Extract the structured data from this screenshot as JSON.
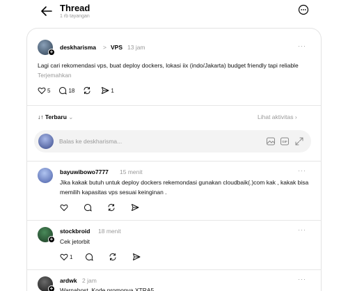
{
  "header": {
    "title": "Thread",
    "subtitle": "1 rb tayangan"
  },
  "post": {
    "username": "deskharisma",
    "separator": ">",
    "community": "VPS",
    "time": "13 jam",
    "more": "···",
    "text": "Lagi cari rekomendasi vps, buat deploy dockers, lokasi iix (indo/Jakarta) budget friendly tapi reliable",
    "translate": "Terjemahkan",
    "likes": "5",
    "comments": "18",
    "reposts": "",
    "shares": "1"
  },
  "sort": {
    "label": "Terbaru",
    "activity": "Lihat aktivitas"
  },
  "reply_box": {
    "placeholder": "Balas ke deskharisma..."
  },
  "replies": [
    {
      "username": "bayuwibowo7777",
      "time": "15 menit",
      "more": "···",
      "text": "Jika kakak butuh untuk deploy dockers rekemondasi gunakan cloudbaik(.)com kak , kakak bisa memilih kapasitas vps sesuai keinginan .",
      "likes": ""
    },
    {
      "username": "stockbroid",
      "time": "18 menit",
      "more": "···",
      "text": "Cek jetorbit",
      "likes": "1"
    },
    {
      "username": "ardwk",
      "time": "2 jam",
      "more": "···",
      "text": "Warnahost. Kode promonya XTRA5"
    }
  ]
}
